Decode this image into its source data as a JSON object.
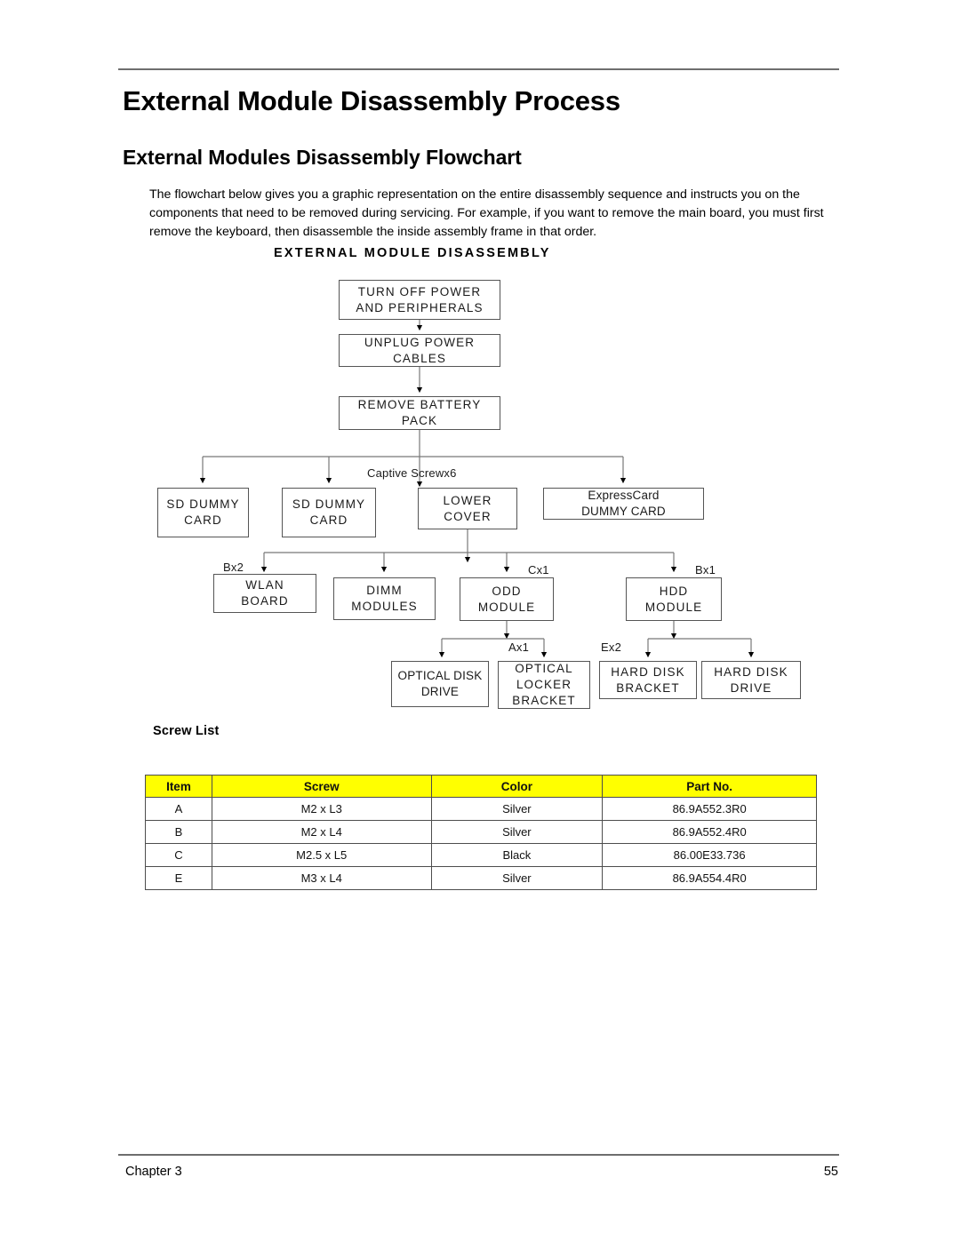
{
  "page": {
    "h1": "External Module Disassembly Process",
    "h2": "External Modules Disassembly Flowchart",
    "intro": "The flowchart below gives you a graphic representation on the entire disassembly sequence and instructs you on the components that need to be removed during servicing. For example, if you want to remove the main board, you must first remove the keyboard, then disassemble the inside assembly frame in that order."
  },
  "flowchart": {
    "title": "EXTERNAL MODULE DISASSEMBLY",
    "nodes": {
      "turn_off_power": {
        "line1": "TURN OFF POWER",
        "line2": "AND PERIPHERALS",
        "line3": ""
      },
      "unplug_power": {
        "line1": "UNPLUG POWER",
        "line2": "CABLES",
        "line3": ""
      },
      "remove_battery": {
        "line1": "REMOVE BATTERY",
        "line2": "PACK",
        "line3": ""
      },
      "sd_dummy_1": {
        "line1": "SD DUMMY",
        "line2": "CARD",
        "line3": ""
      },
      "sd_dummy_2": {
        "line1": "SD DUMMY",
        "line2": "CARD",
        "line3": ""
      },
      "lower_cover": {
        "line1": "LOWER",
        "line2": "COVER",
        "line3": ""
      },
      "expresscard": {
        "line1": "ExpressCard",
        "line2": "DUMMY CARD",
        "line3": ""
      },
      "wlan_board": {
        "line1": "WLAN",
        "line2": "BOARD",
        "line3": ""
      },
      "dimm_modules": {
        "line1": "DIMM",
        "line2": "MODULES",
        "line3": ""
      },
      "odd_module": {
        "line1": "ODD",
        "line2": "MODULE",
        "line3": ""
      },
      "hdd_module": {
        "line1": "HDD",
        "line2": "MODULE",
        "line3": ""
      },
      "optical_disk_drive": {
        "line1": "OPTICAL DISK",
        "line2": "DRIVE",
        "line3": ""
      },
      "optical_locker": {
        "line1": "OPTICAL",
        "line2": "LOCKER",
        "line3": "BRACKET"
      },
      "hard_disk_bracket": {
        "line1": "HARD DISK",
        "line2": "BRACKET",
        "line3": ""
      },
      "hard_disk_drive": {
        "line1": "HARD DISK",
        "line2": "DRIVE",
        "line3": ""
      }
    },
    "edge_labels": {
      "captive_screw": "Captive Screwx6",
      "bx2": "Bx2",
      "cx1": "Cx1",
      "bx1": "Bx1",
      "ax1": "Ax1",
      "ex2": "Ex2"
    }
  },
  "screw_list": {
    "title": "Screw List",
    "header_color": "#ffff00",
    "columns": [
      "Item",
      "Screw",
      "Color",
      "Part No."
    ],
    "rows": [
      {
        "item": "A",
        "screw": "M2 x L3",
        "color": "Silver",
        "part_no": "86.9A552.3R0"
      },
      {
        "item": "B",
        "screw": "M2 x L4",
        "color": "Silver",
        "part_no": "86.9A552.4R0"
      },
      {
        "item": "C",
        "screw": "M2.5 x L5",
        "color": "Black",
        "part_no": "86.00E33.736"
      },
      {
        "item": "E",
        "screw": "M3 x L4",
        "color": "Silver",
        "part_no": "86.9A554.4R0"
      }
    ]
  },
  "footer": {
    "chapter": "Chapter 3",
    "page_number": "55"
  }
}
